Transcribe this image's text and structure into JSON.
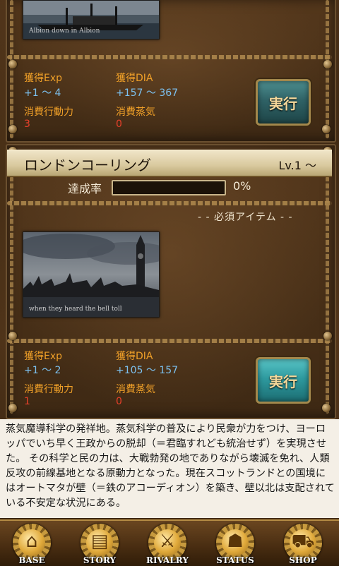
{
  "quest_prev": {
    "thumbnail_caption": "Albion down in Albion",
    "exp_label": "獲得Exp",
    "exp_value": "+1 ～ 4",
    "dia_label": "獲得DIA",
    "dia_value": "+157 ～ 367",
    "action_label": "消費行動力",
    "action_value": "3",
    "steam_label": "消費蒸気",
    "steam_value": "0",
    "execute_label": "実行"
  },
  "quest_current": {
    "title": "ロンドンコーリング",
    "level": "Lv.1 ～",
    "progress_label": "達成率",
    "progress_value": "0%",
    "progress_fraction": 0,
    "required_items_label": "- - 必須アイテム - -",
    "thumbnail_caption": "when they heard the bell toll",
    "exp_label": "獲得Exp",
    "exp_value": "+1 ～ 2",
    "dia_label": "獲得DIA",
    "dia_value": "+105 ～ 157",
    "action_label": "消費行動力",
    "action_value": "1",
    "steam_label": "消費蒸気",
    "steam_value": "0",
    "execute_label": "実行"
  },
  "description": "蒸気魔導科学の発祥地。蒸気科学の普及により民衆が力をつけ、ヨーロッパでいち早く王政からの脱却（＝君臨すれども統治せず）を実現させた。 その科学と民の力は、大戦勃発の地でありながら壊滅を免れ、人類反攻の前線基地となる原動力となった。現在スコットランドとの国境にはオートマタが壁（＝鉄のアコーディオン）を築き、壁以北は支配されている不安定な状況にある。",
  "nav": [
    {
      "label": "BASE",
      "icon": "house-icon"
    },
    {
      "label": "STORY",
      "icon": "book-icon"
    },
    {
      "label": "RIVALRY",
      "icon": "crossed-swords-icon"
    },
    {
      "label": "STATUS",
      "icon": "person-icon"
    },
    {
      "label": "SHOP",
      "icon": "cart-icon"
    }
  ],
  "colors": {
    "label_orange": "#f0a028",
    "value_blue": "#7cc0ee",
    "value_red": "#e8402a",
    "button_teal": "#2e9a9f"
  }
}
